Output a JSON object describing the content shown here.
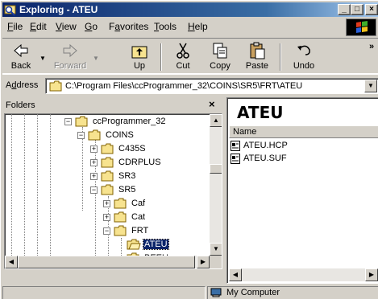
{
  "window": {
    "title": "Exploring - ATEU",
    "controls": {
      "minimize": "_",
      "maximize": "□",
      "close": "×"
    }
  },
  "menu": [
    {
      "pre": "",
      "u": "F",
      "post": "ile"
    },
    {
      "pre": "",
      "u": "E",
      "post": "dit"
    },
    {
      "pre": "",
      "u": "V",
      "post": "iew"
    },
    {
      "pre": "",
      "u": "G",
      "post": "o"
    },
    {
      "pre": "F",
      "u": "a",
      "post": "vorites"
    },
    {
      "pre": "",
      "u": "T",
      "post": "ools"
    },
    {
      "pre": "",
      "u": "H",
      "post": "elp"
    }
  ],
  "toolbar": {
    "back": "Back",
    "forward": "Forward",
    "up": "Up",
    "cut": "Cut",
    "copy": "Copy",
    "paste": "Paste",
    "undo": "Undo",
    "more": "»"
  },
  "address": {
    "label_pre": "A",
    "label_u": "d",
    "label_post": "dress",
    "value": "C:\\Program Files\\ccProgrammer_32\\COINS\\SR5\\FRT\\ATEU",
    "drop": "▼"
  },
  "folders": {
    "header": "Folders",
    "close": "×",
    "nodes": [
      {
        "label": "ccProgrammer_32",
        "exp": "−",
        "depth": 0,
        "open": true
      },
      {
        "label": "COINS",
        "exp": "−",
        "depth": 1,
        "open": true
      },
      {
        "label": "C435S",
        "exp": "+",
        "depth": 2,
        "open": false
      },
      {
        "label": "CDRPLUS",
        "exp": "+",
        "depth": 2,
        "open": false
      },
      {
        "label": "SR3",
        "exp": "+",
        "depth": 2,
        "open": false
      },
      {
        "label": "SR5",
        "exp": "−",
        "depth": 2,
        "open": true
      },
      {
        "label": "Caf",
        "exp": "+",
        "depth": 3,
        "open": false
      },
      {
        "label": "Cat",
        "exp": "+",
        "depth": 3,
        "open": false
      },
      {
        "label": "FRT",
        "exp": "−",
        "depth": 3,
        "open": true
      },
      {
        "label": "ATEU",
        "exp": "",
        "depth": 4,
        "open": true,
        "selected": true
      },
      {
        "label": "BEEU",
        "exp": "",
        "depth": 4,
        "open": false
      }
    ]
  },
  "content": {
    "title": "ATEU",
    "column_name": "Name",
    "files": [
      "ATEU.HCP",
      "ATEU.SUF"
    ]
  },
  "status": {
    "location": "My Computer"
  }
}
